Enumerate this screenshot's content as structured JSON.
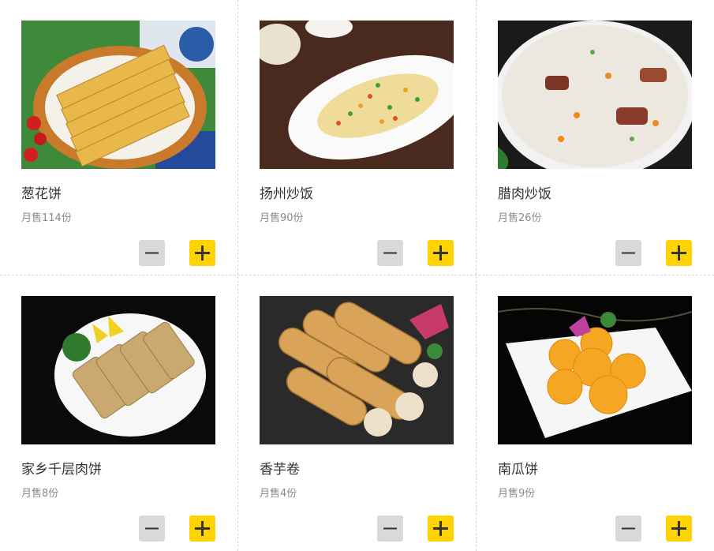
{
  "theme": {
    "add_button_color": "#ffd300",
    "remove_button_color": "#d9d9d9"
  },
  "items": [
    {
      "name": "葱花饼",
      "sales": "月售114份",
      "photo": "scallion-pancake-photo"
    },
    {
      "name": "扬州炒饭",
      "sales": "月售90份",
      "photo": "yangzhou-fried-rice-photo"
    },
    {
      "name": "腊肉炒饭",
      "sales": "月售26份",
      "photo": "cured-pork-fried-rice-photo"
    },
    {
      "name": "家乡千层肉饼",
      "sales": "月售8份",
      "photo": "layered-meat-pie-photo"
    },
    {
      "name": "香芋卷",
      "sales": "月售4份",
      "photo": "taro-roll-photo"
    },
    {
      "name": "南瓜饼",
      "sales": "月售9份",
      "photo": "pumpkin-cake-photo"
    }
  ],
  "icons": {
    "remove": "minus-icon",
    "add": "plus-icon"
  }
}
